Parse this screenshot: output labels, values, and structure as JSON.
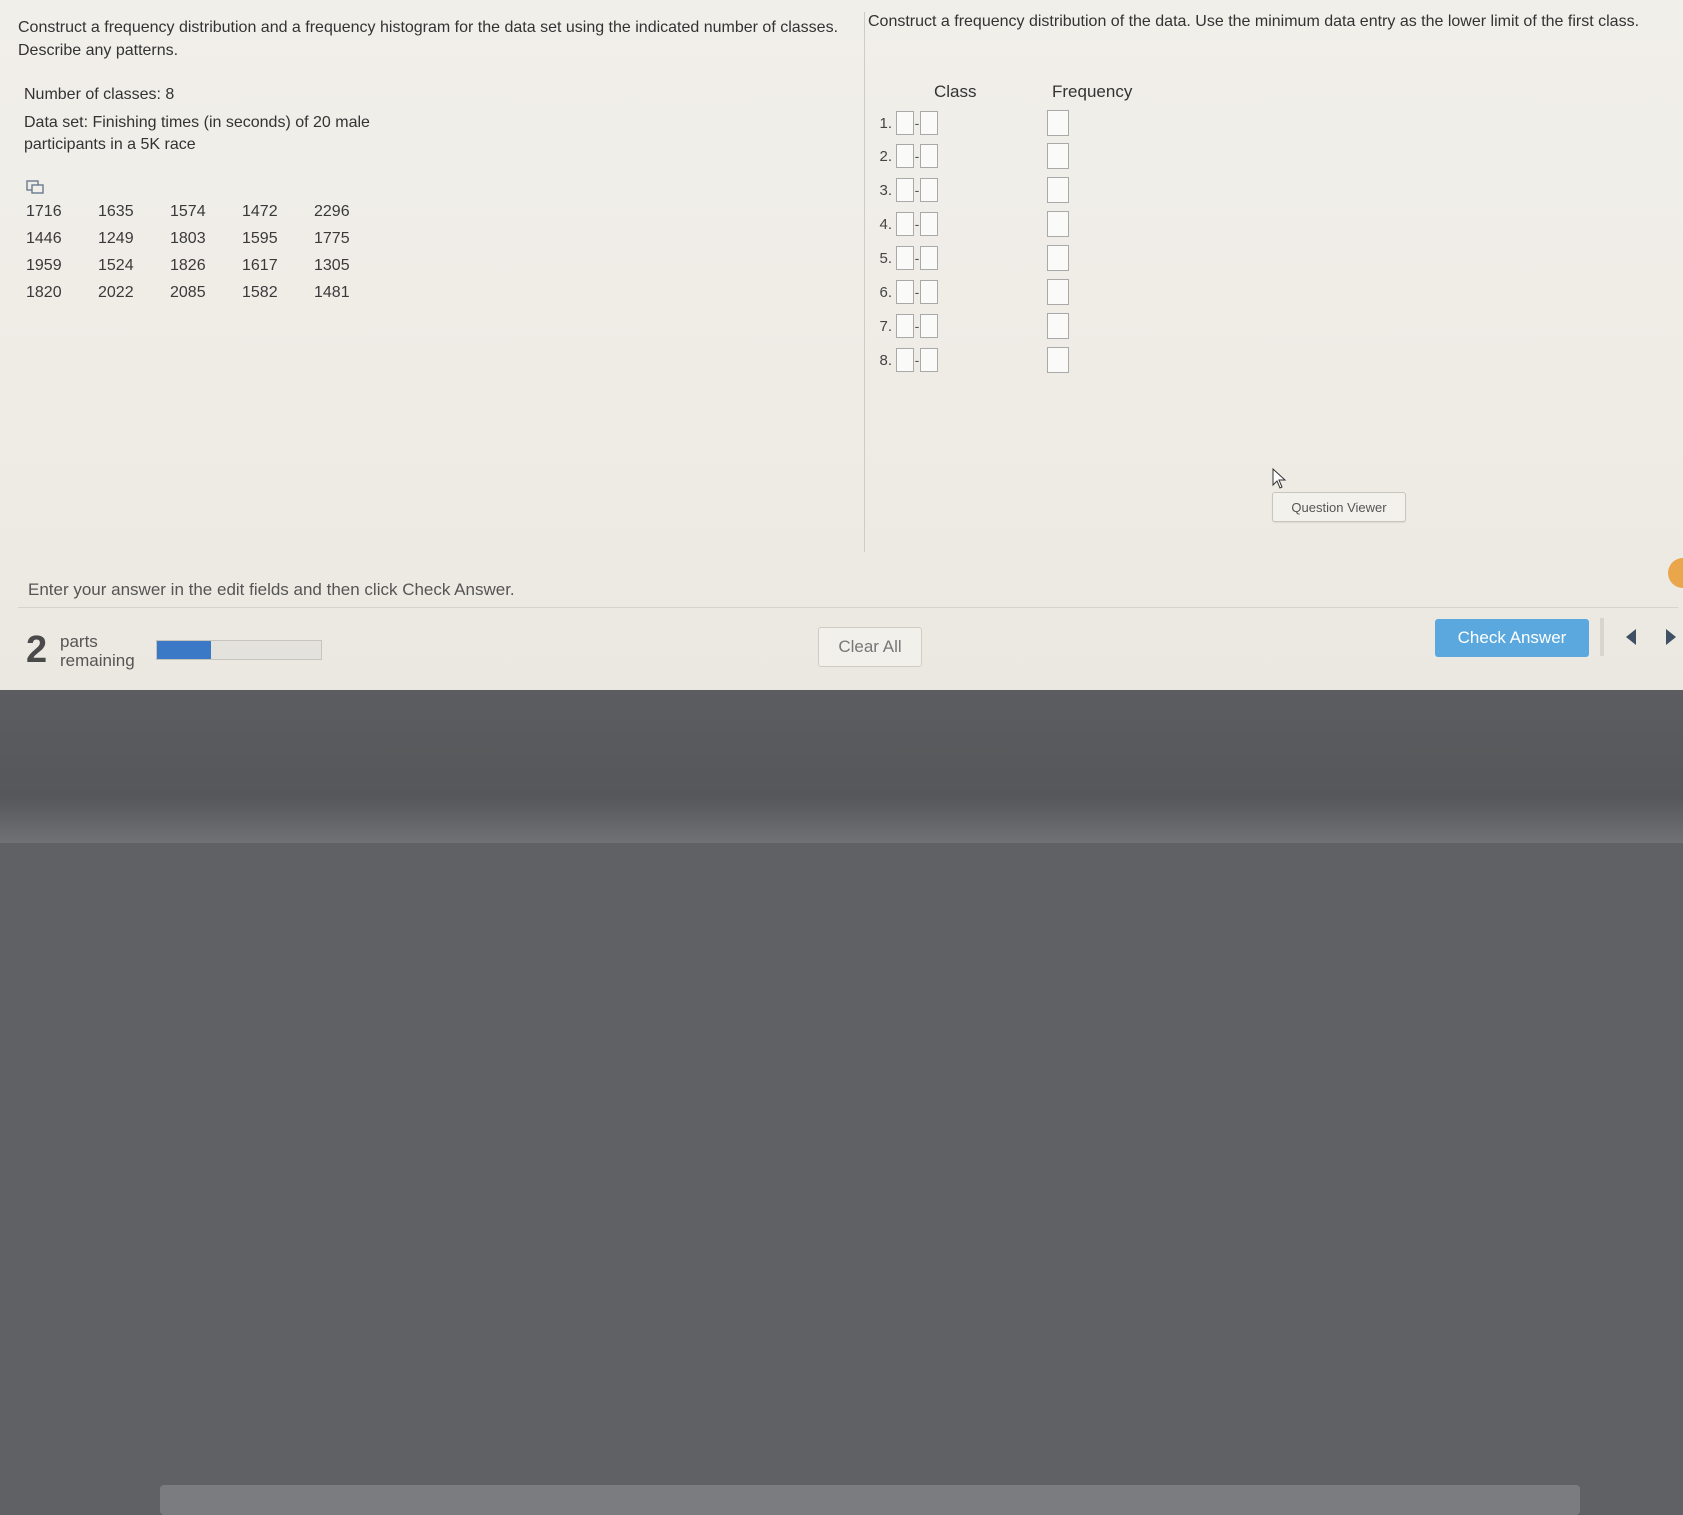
{
  "colors": {
    "accent": "#5aa8de",
    "progress": "#3b78c6"
  },
  "left_question": {
    "prompt": "Construct a frequency distribution and a frequency histogram for the data set using the indicated number of classes. Describe any patterns.",
    "num_classes": "Number of classes: 8",
    "dataset_desc": "Data set: Finishing times (in seconds) of 20 male participants in a 5K race",
    "copy_icon": "copy-icon",
    "data_rows": [
      [
        "1716",
        "1635",
        "1574",
        "1472",
        "2296"
      ],
      [
        "1446",
        "1249",
        "1803",
        "1595",
        "1775"
      ],
      [
        "1959",
        "1524",
        "1826",
        "1617",
        "1305"
      ],
      [
        "1820",
        "2022",
        "2085",
        "1582",
        "1481"
      ]
    ]
  },
  "right_question": {
    "prompt": "Construct a frequency distribution of the data. Use the minimum data entry as the lower limit of the first class.",
    "class_header": "Class",
    "freq_header": "Frequency",
    "row_labels": [
      "1.",
      "2.",
      "3.",
      "4.",
      "5.",
      "6.",
      "7.",
      "8."
    ],
    "dash": "-"
  },
  "question_viewer": "Question Viewer",
  "instruction": "Enter your answer in the edit fields and then click Check Answer.",
  "footer": {
    "parts_count": "2",
    "parts_label_1": "parts",
    "parts_label_2": "remaining",
    "progress_fraction": 0.33,
    "clear_all": "Clear All",
    "check_answer": "Check Answer"
  }
}
